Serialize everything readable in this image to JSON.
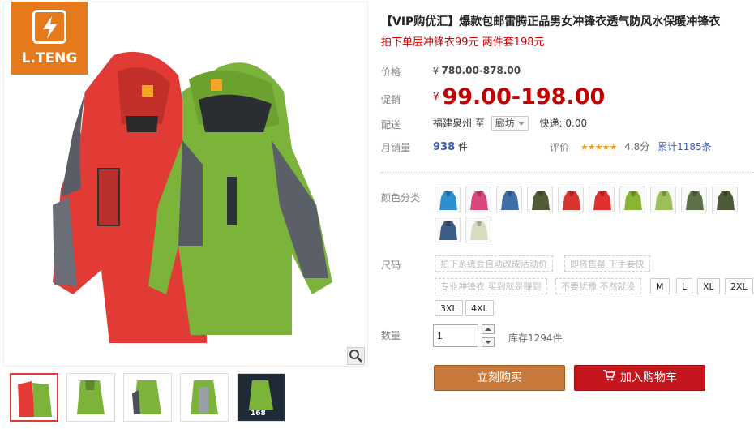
{
  "brand": {
    "logo_text": "L.TENG",
    "logo_color": "#e57a1c"
  },
  "title": "【VIP购优汇】爆款包邮雷腾正品男女冲锋衣透气防风水保暖冲锋衣",
  "subtitle": "拍下单层冲锋衣99元 两件套198元",
  "price": {
    "label": "价格",
    "currency": "¥",
    "original": "780.00-878.00"
  },
  "promo": {
    "label": "促销",
    "currency": "¥",
    "price": "99.00-198.00",
    "color": "#c40000"
  },
  "shipping": {
    "label": "配送",
    "from": "福建泉州",
    "to_word": "至",
    "destination": "廊坊",
    "fee": "快递: 0.00"
  },
  "sales": {
    "label": "月销量",
    "count": "938",
    "unit": "件"
  },
  "rating": {
    "label": "评价",
    "stars": "★★★★★",
    "score": "4.8分",
    "total": "累计1185条"
  },
  "color": {
    "label": "颜色分类",
    "swatches": [
      "#2e8fcf",
      "#d8477b",
      "#3f6fa8",
      "#4f5c36",
      "#d6362f",
      "#e03030",
      "#8ab531",
      "#9cbf58",
      "#5e7048",
      "#4f5a3a",
      "#3c5d86",
      "#d9dcc0"
    ]
  },
  "size": {
    "label": "尺码",
    "disabled_options": [
      "拍下系统会自动改成活动价",
      "即将售罄 下手要快",
      "专业冲锋衣 买到就是赚到",
      "不要犹豫 不然就没"
    ],
    "options": [
      "M",
      "L",
      "XL",
      "2XL",
      "3XL",
      "4XL"
    ]
  },
  "quantity": {
    "label": "数量",
    "value": "1",
    "stock": "库存1294件"
  },
  "actions": {
    "buy_now": "立刻购买",
    "add_to_cart": "加入购物车"
  },
  "thumbnails": [
    "thumb-1",
    "thumb-2",
    "thumb-3",
    "thumb-4",
    "thumb-5"
  ],
  "thumbnail_price_text": "168"
}
